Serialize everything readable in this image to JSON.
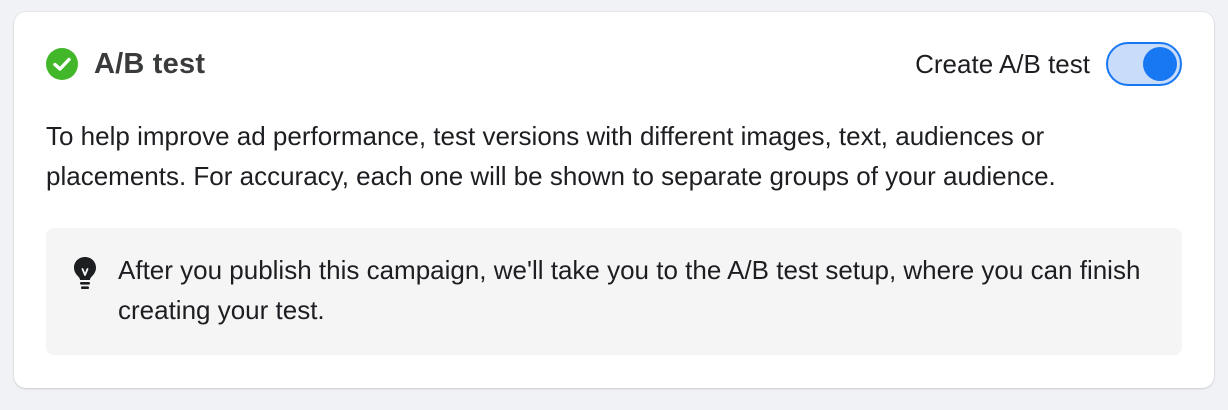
{
  "section": {
    "title": "A/B test",
    "status_icon": "check-circle-icon",
    "status_color": "#42b72a"
  },
  "toggle": {
    "label": "Create A/B test",
    "state": "on",
    "accent_color": "#1877f2"
  },
  "description": "To help improve ad performance, test versions with different images, text, audiences or placements. For accuracy, each one will be shown to separate groups of your audience.",
  "info": {
    "icon": "lightbulb-icon",
    "text": "After you publish this campaign, we'll take you to the A/B test setup, where you can finish creating your test."
  }
}
